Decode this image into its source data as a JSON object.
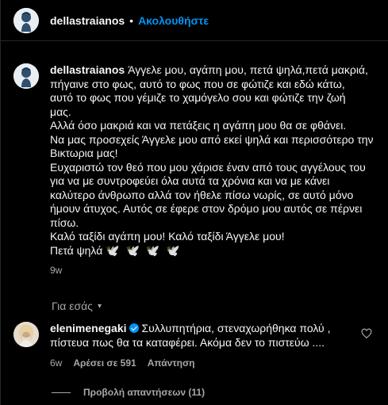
{
  "header": {
    "username": "dellastraianos",
    "separator": "•",
    "follow_label": "Ακολουθήστε"
  },
  "caption": {
    "username": "dellastraianos",
    "lines": [
      "Άγγελε μου, αγάπη μου, πετά ψηλά,πετά μακριά,",
      "πήγαινε στο φως, αυτό το φως που σε φώτιζε και εδώ κάτω,",
      "αυτό το φως που γέμιζε το χαμόγελο σου και φώτιζε την ζωή",
      "μας.",
      "Αλλά όσο μακριά και να πετάξεις η αγάπη μου θα σε φθάνει.",
      "Να μας προσεχείς Άγγελε μου από εκεί ψηλά και περισσότερο την",
      "Βικτωρια μας!",
      "Ευχαριστώ τον θεό που μου χάρισε έναν από τους αγγέλους του",
      "για να με συντροφεύει όλα αυτά τα χρόνια και να με κάνει",
      "καλύτερο άνθρωπο αλλά τον ήθελε πίσω νωρίς, σε αυτό μόνο",
      "ήμουν άτυχος. Αυτός σε έφερε στον δρόμο μου αυτός σε πέρνει",
      "πίσω.",
      "Καλό ταξίδι αγάπη μου! Καλό ταξίδι Άγγελε μου!",
      "Πετά ψηλά"
    ],
    "doves": "🕊️ 🕊️ 🕊️ 🕊️",
    "time": "9w"
  },
  "section": {
    "label": "Για εσάς",
    "chevron": "▾"
  },
  "comment": {
    "username": "elenimenegaki",
    "lines": [
      "Συλλυπητήρια, στεναχωρήθηκα πολύ ,",
      "πίστευα πως θα τα καταφέρει. Ακόμα δεν το πιστεύω ...."
    ],
    "time": "6w",
    "likes": "Αρέσει σε 591",
    "reply": "Απάντηση",
    "view_replies": "Προβολή απαντήσεων (11)"
  },
  "icons": {
    "verified": "verified-badge-icon",
    "heart": "heart-icon"
  },
  "colors": {
    "background": "#000000",
    "text": "#f5f5f5",
    "muted": "#a8a8a8",
    "link": "#0095f6"
  }
}
